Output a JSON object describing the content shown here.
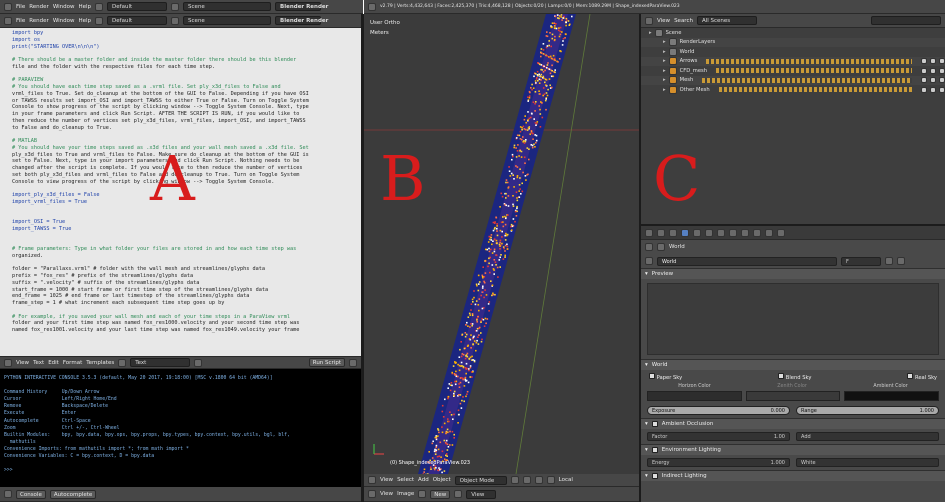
{
  "top_left_bar": {
    "menus": [
      "File",
      "Render",
      "Window",
      "Help"
    ],
    "layout_value": "Default",
    "scene_value": "Scene",
    "engine_value": "Blender Render"
  },
  "top_right_bar": {
    "info_text": "v2.79 | Verts:4,432,643 | Faces:2,425,370 | Tris:4,468,128 | Objects:0/20 | Lamps:0/0 | Mem:1089.29M | Shape_indexedParaView.023"
  },
  "second_bar": {
    "menus": [
      "File",
      "Render",
      "Window",
      "Help"
    ],
    "layout_value": "Default",
    "scene_value": "Scene",
    "engine_value": "Blender Render"
  },
  "text_editor": {
    "lines": [
      "import bpy",
      "import os",
      "print(\"STARTING OVER\\n\\n\\n\")",
      "",
      "# There should be a master folder and inside the master folder there should be this blender",
      "file and the folder with the respective files for each time step.",
      "",
      "# PARAVIEW",
      "# You should have each time step saved as a .vrml file. Set ply_x3d_files to False and",
      "vrml_files to True. Set do_cleanup at the bottom of the GUI to False. Depending if you have OSI",
      "or TAWSS results set import_OSI and import_TAWSS to either True or False. Turn on Toggle System",
      "Console to show progress of the script by clicking window --> Toggle System Console. Next, type",
      "in your frame parameters and click Run Script. AFTER THE SCRIPT IS RUN, if you would like to",
      "then reduce the number of vertices set ply_x3d_files, vrml_files, import_OSI, and import_TAWSS",
      "to False and do_cleanup to True.",
      "",
      "# MATLAB",
      "# You should have your time steps saved as .x3d files and your wall mesh saved a .x3d file. Set",
      "ply_x3d_files to True and vrml_files to False. Make sure do_cleanup at the bottom of the GUI is",
      "set to False. Next, type in your import parameters and click Run Script. Nothing needs to be",
      "changed after the script is complete. If you would like to then reduce the number of vertices",
      "set both ply_x3d_files and vrml_files to False and do_cleanup to True. Turn on Toggle System",
      "Console to view progress of the script by clicking window --> Toggle System Console.",
      "",
      "import_ply_x3d_files = False",
      "import_vrml_files = True",
      "",
      "",
      "import_OSI = True",
      "import_TAWSS = True",
      "",
      "",
      "# Frame parameters: Type in what folder your files are stored in and how each time step was",
      "organized.",
      "",
      "folder = \"Parallaxs.vrml\" # folder with the wall mesh and streamlines/glyphs data",
      "prefix = \"fox_res\" # prefix of the streamlines/glyphs data",
      "suffix = \".velocity\" # suffix of the streamlines/glyphs data",
      "start_frame = 1000 # start frame or first time step of the streamlines/glyphs data",
      "end_frame = 1025 # end frame or last timestep of the streamlines/glyphs data",
      "frame_step = 1 # what increment each subsequent time step goes up by",
      "",
      "# For example, if you saved your wall mesh and each of your time steps in a ParaView vrml",
      "folder and your first time step was named fox_res1000.velocity and your second time step was",
      "named fox_res1001.velocity and your last time step was named fox_res1049.velocity your frame"
    ]
  },
  "text_header": {
    "menus": [
      "View",
      "Text",
      "Edit",
      "Format",
      "Templates"
    ],
    "file_name": "Text",
    "run_script": "Run Script"
  },
  "console": {
    "lines": [
      "PYTHON INTERACTIVE CONSOLE 3.5.3 (default, May 20 2017, 19:18:00) [MSC v.1800 64 bit (AMD64)]",
      "",
      "Command History     Up/Down Arrow",
      "Cursor              Left/Right Home/End",
      "Remove              Backspace/Delete",
      "Execute             Enter",
      "Autocomplete        Ctrl-Space",
      "Zoom                Ctrl +/-, Ctrl-Wheel",
      "Builtin Modules:    bpy, bpy.data, bpy.ops, bpy.props, bpy.types, bpy.context, bpy.utils, bgl, blf,",
      "  mathutils",
      "Convenience Imports: from mathutils import *; from math import *",
      "Convenience Variables: C = bpy.context, D = bpy.data",
      "",
      ">>> "
    ]
  },
  "console_header": {
    "tabs": [
      "Console",
      "Autocomplete"
    ]
  },
  "viewport": {
    "view_label": "User Ortho",
    "units_label": "Meters",
    "object_label": "(0) Shape_indexedParaView.023",
    "menus": [
      "View",
      "Select",
      "Add",
      "Object"
    ],
    "mode": "Object Mode",
    "shading": "Local"
  },
  "image_header": {
    "menus": [
      "View",
      "Image"
    ],
    "new_button": "New",
    "view_label": "View"
  },
  "outliner": {
    "header_menus": [
      "View",
      "Search"
    ],
    "filter_value": "All Scenes",
    "items": [
      {
        "label": "Scene",
        "indent": 0
      },
      {
        "label": "RenderLayers",
        "indent": 1
      },
      {
        "label": "World",
        "indent": 1
      },
      {
        "label": "Arrows",
        "indent": 1
      },
      {
        "label": "CFD_mesh",
        "indent": 1
      },
      {
        "label": "Mesh",
        "indent": 1
      },
      {
        "label": "Other Mesh",
        "indent": 1
      }
    ]
  },
  "properties": {
    "world_tab": "World",
    "world_name": "World",
    "world_users": "F",
    "preview_panel": "Preview",
    "world_panel": "World",
    "paper_sky": "Paper Sky",
    "blend_sky": "Blend Sky",
    "real_sky": "Real Sky",
    "horizon_color": "Horizon Color",
    "zenith_color": "Zenith Color",
    "ambient_color": "Ambient Color",
    "exposure_label": "Exposure",
    "exposure_value": "0.000",
    "range_label": "Range",
    "range_value": "1.000",
    "ambient_occlusion": "Ambient Occlusion",
    "factor_label": "Factor",
    "factor_value": "1.00",
    "add_label": "Add",
    "environment_lighting": "Environment Lighting",
    "energy_label": "Energy",
    "energy_value": "1.000",
    "white_label": "White",
    "indirect_lighting": "Indirect Lighting"
  },
  "overlay_letters": {
    "a": "A",
    "b": "B",
    "c": "C"
  },
  "colors": {
    "text_bg": "#e8e8e8",
    "code_comment": "#2e8b57",
    "code_keyword": "#1a3ea8",
    "letter_red": "#d81c1c",
    "viewport_bg": "#3b3b3b"
  }
}
